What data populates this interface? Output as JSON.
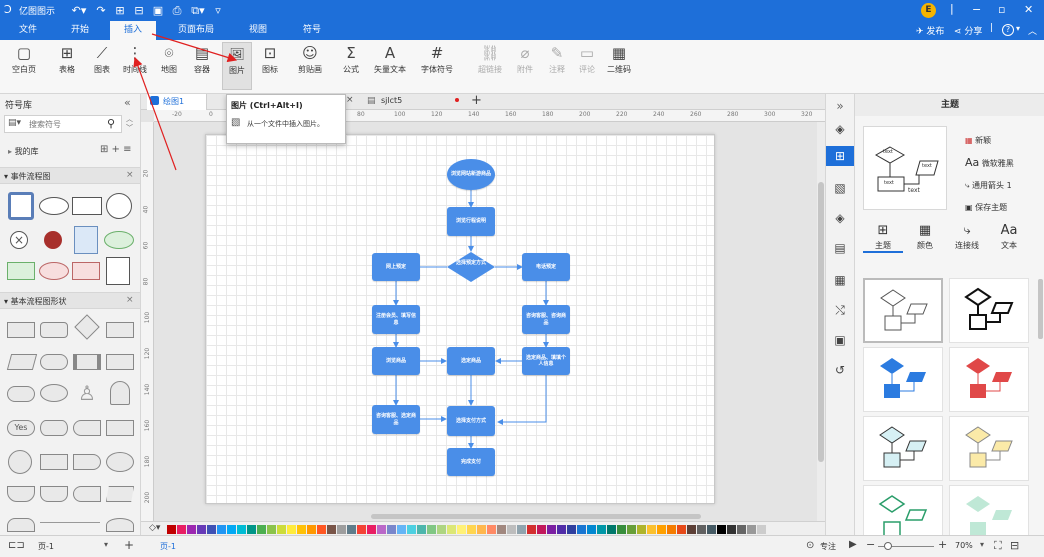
{
  "titlebar": {
    "app_name": "亿图图示",
    "quick_icons": [
      "↶▾",
      "↷",
      "⊞",
      "⊟",
      "▣",
      "⎙",
      "⧉▾",
      "▿"
    ],
    "user_initial": "E",
    "window_controls": [
      "−",
      "▫",
      "✕"
    ]
  },
  "menubar": {
    "items": [
      "文件",
      "开始",
      "插入",
      "页面布局",
      "视图",
      "符号"
    ],
    "active": "插入",
    "right": {
      "publish": "发布",
      "share": "分享",
      "help": "?"
    }
  },
  "ribbon": {
    "buttons": [
      {
        "label": "空白页",
        "icon": "▢"
      },
      {
        "label": "表格",
        "icon": "⊞"
      },
      {
        "label": "图表",
        "icon": "⟋"
      },
      {
        "label": "时间线",
        "icon": "⋮"
      },
      {
        "label": "地图",
        "icon": "⌾"
      },
      {
        "label": "容器",
        "icon": "▤"
      },
      {
        "label": "图片",
        "icon": "🖼"
      },
      {
        "label": "图标",
        "icon": "⊡"
      },
      {
        "label": "剪贴画",
        "icon": "☺"
      },
      {
        "label": "公式",
        "icon": "Σ"
      },
      {
        "label": "矢量文本",
        "icon": "A"
      },
      {
        "label": "字体符号",
        "icon": "#"
      },
      {
        "label": "超链接",
        "icon": "⛓"
      },
      {
        "label": "附件",
        "icon": "⌀"
      },
      {
        "label": "注释",
        "icon": "✎"
      },
      {
        "label": "评论",
        "icon": "▭"
      },
      {
        "label": "二维码",
        "icon": "▦"
      }
    ]
  },
  "tooltip": {
    "title": "图片 (Ctrl+Alt+I)",
    "desc": "从一个文件中插入图片。"
  },
  "symbol_library": {
    "title": "符号库",
    "search_placeholder": "搜索符号",
    "my_library": "我的库",
    "section_event": "事件流程图",
    "section_basic": "基本流程图形状",
    "yes_label": "Yes"
  },
  "tabs": {
    "items": [
      {
        "label": "绘图1"
      },
      {
        "label": "sjlct5"
      }
    ]
  },
  "ruler": {
    "h_ticks": [
      "-20",
      "0",
      "20",
      "40",
      "60",
      "80",
      "100",
      "120",
      "140",
      "160",
      "180",
      "200",
      "220",
      "240",
      "260",
      "280",
      "300",
      "320"
    ],
    "v_ticks": [
      "20",
      "40",
      "60",
      "80",
      "100",
      "120",
      "140",
      "160",
      "180",
      "200"
    ]
  },
  "flowchart": {
    "nodes": {
      "start": "浏览网站新游商品",
      "browse": "浏览行程说明",
      "decide": "选择预定方式",
      "online": "网上预定",
      "phone": "电话预定",
      "register": "注册会员、填写信息",
      "consult_phone": "咨询客服、咨询商品",
      "browse_goods": "浏览商品",
      "choose": "选定商品",
      "choose_fill": "选定商品、填填个人信息",
      "consult_choose": "咨询客服、选定商品",
      "pay_method": "选择支付方式",
      "done": "完成支付"
    }
  },
  "theme_panel": {
    "title": "主题",
    "options": [
      "新颖",
      "微软雅黑",
      "通用箭头 1",
      "保存主题"
    ],
    "font_sample": "Aa",
    "preview_labels": [
      "text",
      "text",
      "text",
      "text"
    ],
    "tabs": [
      "主题",
      "颜色",
      "连接线",
      "文本"
    ]
  },
  "statusbar": {
    "page_selector": "页-1",
    "active_page": "页-1",
    "focus": "专注",
    "zoom": "70%"
  },
  "colors": {
    "accent": "#1e6fd9",
    "node": "#4a8ee8",
    "arrow": "#e02020"
  },
  "palette": [
    "#c00000",
    "#e81e63",
    "#9c27b0",
    "#673ab7",
    "#3f51b5",
    "#2196f3",
    "#03a9f4",
    "#00bcd4",
    "#009688",
    "#4caf50",
    "#8bc34a",
    "#cddc39",
    "#ffeb3b",
    "#ffc107",
    "#ff9800",
    "#ff5722",
    "#795548",
    "#9e9e9e",
    "#607d8b",
    "#f44336",
    "#e91e63",
    "#ba68c8",
    "#7986cb",
    "#64b5f6",
    "#4dd0e1",
    "#4db6ac",
    "#81c784",
    "#aed581",
    "#dce775",
    "#fff176",
    "#ffd54f",
    "#ffb74d",
    "#ff8a65",
    "#a1887f",
    "#bdbdbd",
    "#90a4ae",
    "#d32f2f",
    "#c2185b",
    "#7b1fa2",
    "#512da8",
    "#303f9f",
    "#1976d2",
    "#0288d1",
    "#0097a7",
    "#00796b",
    "#388e3c",
    "#689f38",
    "#afb42b",
    "#fbc02d",
    "#ffa000",
    "#f57c00",
    "#e64a19",
    "#5d4037",
    "#616161",
    "#455a64",
    "#000000",
    "#333333",
    "#666666",
    "#999999",
    "#cccccc"
  ]
}
